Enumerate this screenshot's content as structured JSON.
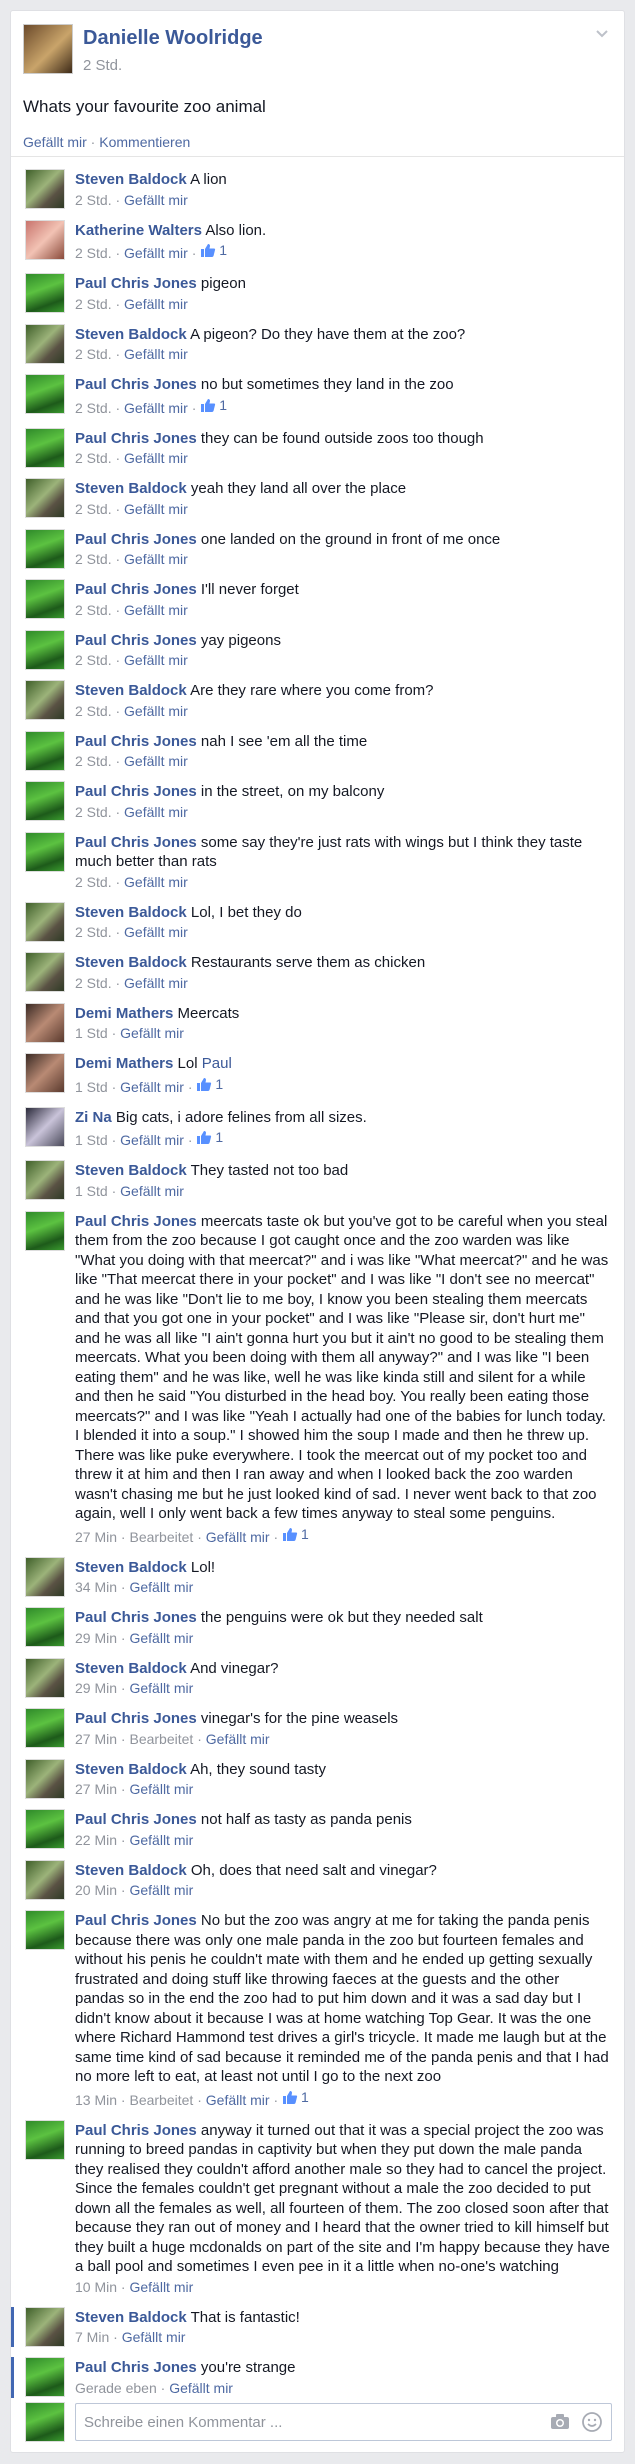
{
  "post": {
    "author": "Danielle Woolridge",
    "time": "2 Std.",
    "text": "Whats your favourite zoo animal",
    "like_label": "Gefällt mir",
    "separator": " · ",
    "comment_label": "Kommentieren"
  },
  "comments": [
    {
      "author": "Steven Baldock",
      "avatar": "baldock",
      "text": "A lion",
      "time": "2 Std.",
      "likes": ""
    },
    {
      "author": "Katherine Walters",
      "avatar": "walters",
      "text": "Also lion.",
      "time": "2 Std.",
      "likes": "1"
    },
    {
      "author": "Paul Chris Jones",
      "avatar": "jones",
      "text": "pigeon",
      "time": "2 Std.",
      "likes": ""
    },
    {
      "author": "Steven Baldock",
      "avatar": "baldock",
      "text": "A pigeon? Do they have them at the zoo?",
      "time": "2 Std.",
      "likes": ""
    },
    {
      "author": "Paul Chris Jones",
      "avatar": "jones",
      "text": "no but sometimes they land in the zoo",
      "time": "2 Std.",
      "likes": "1"
    },
    {
      "author": "Paul Chris Jones",
      "avatar": "jones",
      "text": "they can be found outside zoos too though",
      "time": "2 Std.",
      "likes": ""
    },
    {
      "author": "Steven Baldock",
      "avatar": "baldock",
      "text": "yeah they land all over the place",
      "time": "2 Std.",
      "likes": ""
    },
    {
      "author": "Paul Chris Jones",
      "avatar": "jones",
      "text": "one landed on the ground in front of me once",
      "time": "2 Std.",
      "likes": ""
    },
    {
      "author": "Paul Chris Jones",
      "avatar": "jones",
      "text": "I'll never forget",
      "time": "2 Std.",
      "likes": ""
    },
    {
      "author": "Paul Chris Jones",
      "avatar": "jones",
      "text": "yay pigeons",
      "time": "2 Std.",
      "likes": ""
    },
    {
      "author": "Steven Baldock",
      "avatar": "baldock",
      "text": "Are they rare where you come from?",
      "time": "2 Std.",
      "likes": ""
    },
    {
      "author": "Paul Chris Jones",
      "avatar": "jones",
      "text": "nah I see 'em all the time",
      "time": "2 Std.",
      "likes": ""
    },
    {
      "author": "Paul Chris Jones",
      "avatar": "jones",
      "text": "in the street, on my balcony",
      "time": "2 Std.",
      "likes": ""
    },
    {
      "author": "Paul Chris Jones",
      "avatar": "jones",
      "text": "some say they're just rats with wings but I think they taste much better than rats",
      "time": "2 Std.",
      "likes": ""
    },
    {
      "author": "Steven Baldock",
      "avatar": "baldock",
      "text": "Lol, I bet they do",
      "time": "2 Std.",
      "likes": ""
    },
    {
      "author": "Steven Baldock",
      "avatar": "baldock",
      "text": "Restaurants serve them as chicken",
      "time": "2 Std.",
      "likes": ""
    },
    {
      "author": "Demi Mathers",
      "avatar": "mathers",
      "text": "Meercats",
      "time": "1 Std",
      "likes": ""
    },
    {
      "author": "Demi Mathers",
      "avatar": "mathers",
      "text": "Lol",
      "link": "Paul",
      "time": "1 Std",
      "likes": "1"
    },
    {
      "author": "Zi Na",
      "avatar": "zina",
      "text": "Big cats, i adore felines from all sizes.",
      "time": "1 Std",
      "likes": "1"
    },
    {
      "author": "Steven Baldock",
      "avatar": "baldock",
      "text": "They tasted not too bad",
      "time": "1 Std",
      "likes": ""
    },
    {
      "author": "Paul Chris Jones",
      "avatar": "jones",
      "text": "meercats taste ok but you've got to be careful when you steal them from the zoo because I got caught once and the zoo warden was like \"What you doing with that meercat?\" and i was like \"What meercat?\" and he was like \"That meercat there in your pocket\" and I was like \"I don't see no meercat\" and he was like \"Don't lie to me boy, I know you been stealing them meercats and that you got one in your pocket\" and I was like \"Please sir, don't hurt me\" and he was all like \"I ain't gonna hurt you but it ain't no good to be stealing them meercats. What you been doing with them all anyway?\" and I was like \"I been eating them\" and he was like, well he was like kinda still and silent for a while and then he said \"You disturbed in the head boy. You really been eating those meercats?\" and I was like \"Yeah I actually had one of the babies for lunch today. I blended it into a soup.\" I showed him the soup I made and then he threw up. There was like puke everywhere. I took the meercat out of my pocket too and threw it at him and then I ran away and when I looked back the zoo warden wasn't chasing me but he just looked kind of sad. I never went back to that zoo again, well I only went back a few times anyway to steal some penguins.",
      "time": "27 Min",
      "edited": "Bearbeitet",
      "likes": "1"
    },
    {
      "author": "Steven Baldock",
      "avatar": "baldock",
      "text": "Lol!",
      "time": "34 Min",
      "likes": ""
    },
    {
      "author": "Paul Chris Jones",
      "avatar": "jones",
      "text": "the penguins were ok but they needed salt",
      "time": "29 Min",
      "likes": ""
    },
    {
      "author": "Steven Baldock",
      "avatar": "baldock",
      "text": "And vinegar?",
      "time": "29 Min",
      "likes": ""
    },
    {
      "author": "Paul Chris Jones",
      "avatar": "jones",
      "text": "vinegar's for the pine weasels",
      "time": "27 Min",
      "edited": "Bearbeitet",
      "likes": ""
    },
    {
      "author": "Steven Baldock",
      "avatar": "baldock",
      "text": "Ah, they sound tasty",
      "time": "27 Min",
      "likes": ""
    },
    {
      "author": "Paul Chris Jones",
      "avatar": "jones",
      "text": "not half as tasty as panda penis",
      "time": "22 Min",
      "likes": ""
    },
    {
      "author": "Steven Baldock",
      "avatar": "baldock",
      "text": "Oh, does that need salt and vinegar?",
      "time": "20 Min",
      "likes": ""
    },
    {
      "author": "Paul Chris Jones",
      "avatar": "jones",
      "text": "No but the zoo was angry at me for taking the panda penis because there was only one male panda in the zoo but fourteen females and without his penis he couldn't mate with them and he ended up getting sexually frustrated and doing stuff like throwing faeces at the guests and the other pandas so in the end the zoo had to put him down and it was a sad day but I didn't know about it because I was at home watching Top Gear. It was the one where Richard Hammond test drives a girl's tricycle. It made me laugh but at the same time kind of sad because it reminded me of the panda penis and that I had no more left to eat, at least not until I go to the next zoo",
      "time": "13 Min",
      "edited": "Bearbeitet",
      "likes": "1"
    },
    {
      "author": "Paul Chris Jones",
      "avatar": "jones",
      "text": "anyway it turned out that it was a special project the zoo was running to breed pandas in captivity but when they put down the male panda they realised they couldn't afford another male so they had to cancel the project. Since the females couldn't get pregnant without a male the zoo decided to put down all the females as well, all fourteen of them. The zoo closed soon after that because they ran out of money and I heard that the owner tried to kill himself but they built a huge mcdonalds on part of the site and I'm happy because they have a ball pool and sometimes I even pee in it a little when no-one's watching",
      "time": "10 Min",
      "likes": ""
    },
    {
      "author": "Steven Baldock",
      "avatar": "baldock",
      "text": "That is fantastic!",
      "time": "7 Min",
      "likes": "",
      "highlight": true
    },
    {
      "author": "Paul Chris Jones",
      "avatar": "jones",
      "text": "you're strange",
      "time": "Gerade eben",
      "likes": "",
      "highlight": true
    }
  ],
  "labels": {
    "like": "Gefällt mir",
    "separator": " · "
  },
  "composer": {
    "placeholder": "Schreibe einen Kommentar ..."
  },
  "icons": {
    "options": "chevron-down-icon",
    "like_count": "thumbs-up-icon",
    "camera": "camera-icon",
    "emoji": "smiley-icon"
  },
  "colors": {
    "link": "#3b5998",
    "meta": "#90949c",
    "background": "#e9eaed"
  }
}
